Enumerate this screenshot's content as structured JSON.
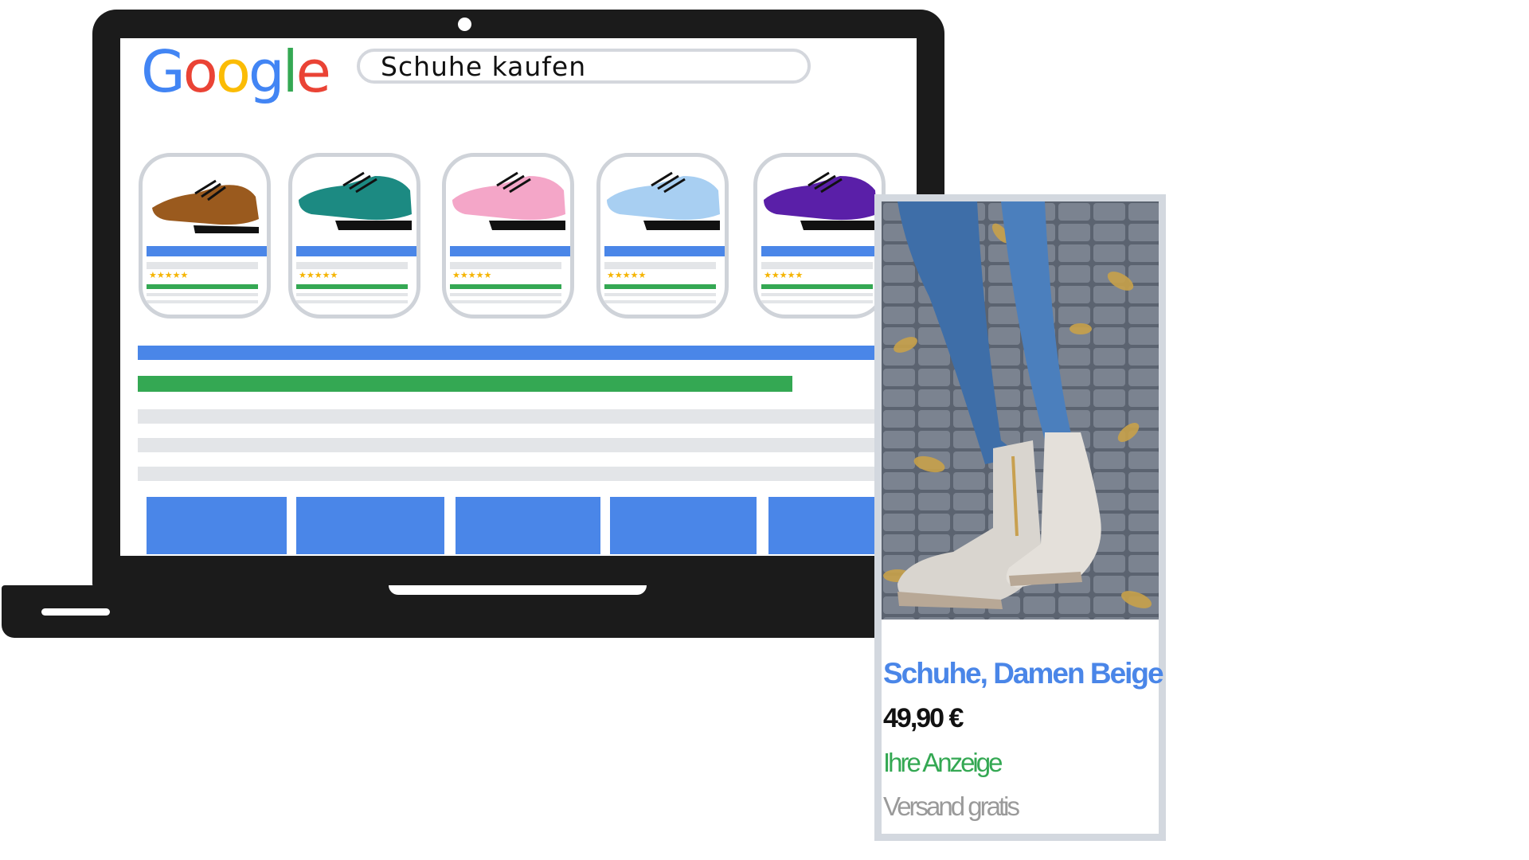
{
  "search": {
    "query": "Schuhe kaufen"
  },
  "google_logo": {
    "letters": [
      "G",
      "o",
      "o",
      "g",
      "l",
      "e"
    ],
    "colors": [
      "#4285f4",
      "#ea4335",
      "#fbbc05",
      "#4285f4",
      "#34a853",
      "#ea4335"
    ]
  },
  "products": [
    {
      "icon": "brown-shoe-icon",
      "color": "#9a5a1e",
      "rating": "★★★★★"
    },
    {
      "icon": "teal-shoe-icon",
      "color": "#1c8a82",
      "rating": "★★★★★"
    },
    {
      "icon": "pink-shoe-icon",
      "color": "#f4a6c8",
      "rating": "★★★★★"
    },
    {
      "icon": "light-blue-shoe-icon",
      "color": "#a8cff2",
      "rating": "★★★★★"
    },
    {
      "icon": "purple-shoe-icon",
      "color": "#5a1fa8",
      "rating": "★★★★★"
    }
  ],
  "colors": {
    "blue": "#4a86e8",
    "green": "#34a853",
    "gray": "#e3e5e8",
    "frame": "#1b1b1b"
  },
  "ad": {
    "image": "beige-boots-photo",
    "title": "Schuhe, Damen Beige",
    "price": "49,90 €",
    "label": "Ihre Anzeige",
    "shipping": "Versand gratis"
  }
}
